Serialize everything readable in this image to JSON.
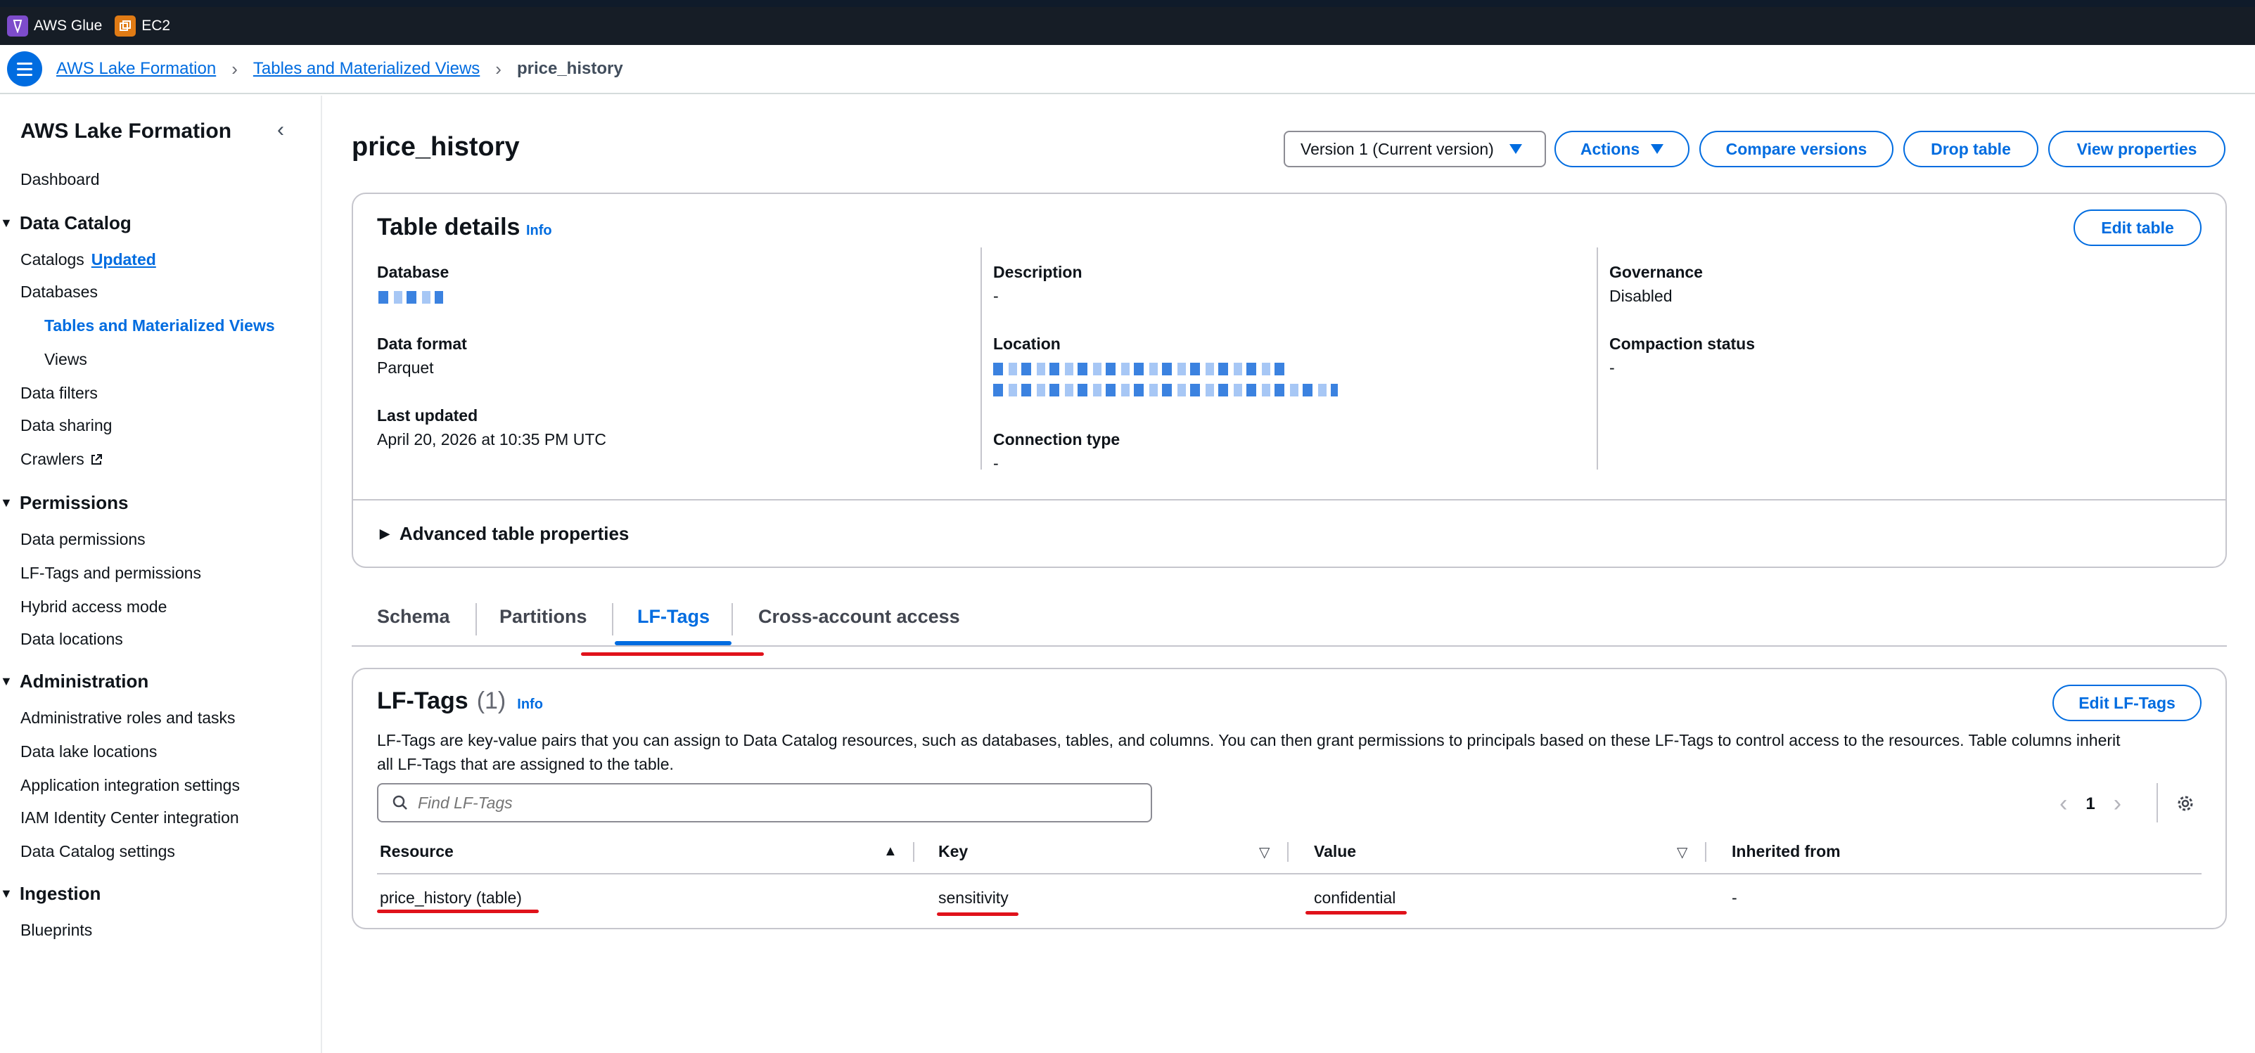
{
  "topbar": {
    "services": [
      {
        "label": "AWS Glue",
        "color": "#7d4ccb",
        "icon": "glue-icon"
      },
      {
        "label": "EC2",
        "color": "#e07b15",
        "icon": "ec2-icon"
      }
    ]
  },
  "breadcrumb": {
    "items": [
      "AWS Lake Formation",
      "Tables and Materialized Views"
    ],
    "current": "price_history"
  },
  "sidebar": {
    "title": "AWS Lake Formation",
    "dashboard": "Dashboard",
    "sections": [
      {
        "label": "Data Catalog",
        "items": [
          "Catalogs",
          "Databases",
          "Tables and Materialized Views",
          "Views",
          "Data filters",
          "Data sharing",
          "Crawlers"
        ]
      },
      {
        "label": "Permissions",
        "items": [
          "Data permissions",
          "LF-Tags and permissions",
          "Hybrid access mode",
          "Data locations"
        ]
      },
      {
        "label": "Administration",
        "items": [
          "Administrative roles and tasks",
          "Data lake locations",
          "Application integration settings",
          "IAM Identity Center integration",
          "Data Catalog settings"
        ]
      },
      {
        "label": "Ingestion",
        "items": [
          "Blueprints"
        ]
      }
    ],
    "catalogs_badge": "Updated",
    "active_item": "Tables and Materialized Views"
  },
  "page": {
    "title": "price_history",
    "version_select": "Version 1 (Current version)",
    "actions_label": "Actions",
    "compare_label": "Compare versions",
    "drop_label": "Drop table",
    "view_props_label": "View properties"
  },
  "table_details": {
    "title": "Table details",
    "info": "Info",
    "edit_label": "Edit table",
    "database_label": "Database",
    "data_format_label": "Data format",
    "data_format": "Parquet",
    "last_updated_label": "Last updated",
    "last_updated": "April 20, 2026 at 10:35 PM UTC",
    "description_label": "Description",
    "description": "-",
    "location_label": "Location",
    "connection_type_label": "Connection type",
    "connection_type": "-",
    "governance_label": "Governance",
    "governance": "Disabled",
    "compaction_label": "Compaction status",
    "compaction": "-",
    "advanced_label": "Advanced table properties"
  },
  "tabs": [
    "Schema",
    "Partitions",
    "LF-Tags",
    "Cross-account access"
  ],
  "active_tab": "LF-Tags",
  "lftags": {
    "title": "LF-Tags",
    "count": "(1)",
    "info": "Info",
    "edit_label": "Edit LF-Tags",
    "description_line1": "LF-Tags are key-value pairs that you can assign to Data Catalog resources, such as databases, tables, and columns. You can then grant permissions to principals based on these LF-Tags to control access to the resources. Table columns inherit",
    "description_line2": "all LF-Tags that are assigned to the table.",
    "search_placeholder": "Find LF-Tags",
    "page_number": "1",
    "columns": [
      "Resource",
      "Key",
      "Value",
      "Inherited from"
    ],
    "rows": [
      {
        "resource": "price_history (table)",
        "key": "sensitivity",
        "value": "confidential",
        "inherited_from": "-"
      }
    ]
  },
  "colors": {
    "accent": "#006ce0",
    "annotation_red": "#e0121b",
    "topbar": "#161d26"
  }
}
